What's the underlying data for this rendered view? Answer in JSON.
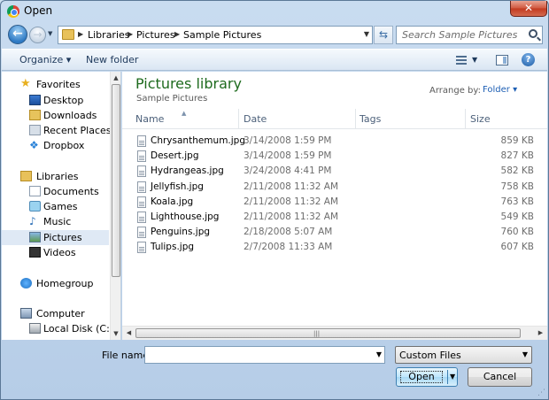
{
  "window": {
    "title": "Open",
    "close_glyph": "✕"
  },
  "nav": {
    "back_glyph": "←",
    "forward_glyph": "→",
    "dropdown_glyph": "▼"
  },
  "address": {
    "crumbs": [
      "Libraries",
      "Pictures",
      "Sample Pictures"
    ],
    "separator": "▶",
    "dropdown_glyph": "▼"
  },
  "refresh_glyph": "⇆",
  "search": {
    "placeholder": "Search Sample Pictures"
  },
  "toolbar": {
    "organize_label": "Organize ▾",
    "new_folder_label": "New folder",
    "view_dropdown_glyph": "▼",
    "help_glyph": "?"
  },
  "sidebar": {
    "groups": [
      {
        "label": "Favorites",
        "icon": "star-icon"
      },
      {
        "label": "Libraries",
        "icon": "libraries-icon"
      },
      {
        "label": "Homegroup",
        "icon": "homegroup-icon"
      },
      {
        "label": "Computer",
        "icon": "computer-icon"
      }
    ],
    "items": [
      {
        "label": "Desktop",
        "icon": "desktop-icon"
      },
      {
        "label": "Downloads",
        "icon": "downloads-icon"
      },
      {
        "label": "Recent Places",
        "icon": "recent-places-icon"
      },
      {
        "label": "Dropbox",
        "icon": "dropbox-icon"
      },
      {
        "label": "Documents",
        "icon": "documents-icon"
      },
      {
        "label": "Games",
        "icon": "games-icon"
      },
      {
        "label": "Music",
        "icon": "music-icon"
      },
      {
        "label": "Pictures",
        "icon": "pictures-icon",
        "selected": true
      },
      {
        "label": "Videos",
        "icon": "videos-icon"
      },
      {
        "label": "Local Disk (C:)",
        "icon": "local-disk-icon"
      }
    ],
    "scroll_up_glyph": "▲",
    "scroll_down_glyph": "▼"
  },
  "library": {
    "title": "Pictures library",
    "subtitle": "Sample Pictures",
    "arrange_label": "Arrange by:",
    "arrange_value": "Folder ▾"
  },
  "columns": [
    "Name",
    "Date",
    "Tags",
    "Size"
  ],
  "sort_glyph": "▲",
  "files": [
    {
      "name": "Chrysanthemum.jpg",
      "date": "3/14/2008 1:59 PM",
      "size": "859 KB"
    },
    {
      "name": "Desert.jpg",
      "date": "3/14/2008 1:59 PM",
      "size": "827 KB"
    },
    {
      "name": "Hydrangeas.jpg",
      "date": "3/24/2008 4:41 PM",
      "size": "582 KB"
    },
    {
      "name": "Jellyfish.jpg",
      "date": "2/11/2008 11:32 AM",
      "size": "758 KB"
    },
    {
      "name": "Koala.jpg",
      "date": "2/11/2008 11:32 AM",
      "size": "763 KB"
    },
    {
      "name": "Lighthouse.jpg",
      "date": "2/11/2008 11:32 AM",
      "size": "549 KB"
    },
    {
      "name": "Penguins.jpg",
      "date": "2/18/2008 5:07 AM",
      "size": "760 KB"
    },
    {
      "name": "Tulips.jpg",
      "date": "2/7/2008 11:33 AM",
      "size": "607 KB"
    }
  ],
  "hscroll": {
    "left_glyph": "◀",
    "right_glyph": "▶",
    "grip_glyph": "|||"
  },
  "bottom": {
    "file_name_label": "File name:",
    "file_name_value": "",
    "filter_value": "Custom Files",
    "dropdown_glyph": "▼",
    "open_label": "Open",
    "cancel_label": "Cancel",
    "grip_glyph": "⋰"
  }
}
